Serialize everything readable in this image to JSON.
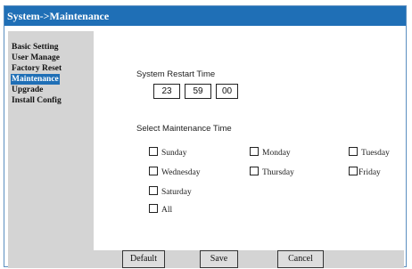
{
  "header": {
    "title": "System->Maintenance"
  },
  "sidebar": {
    "items": [
      {
        "label": "Basic Setting",
        "active": false
      },
      {
        "label": "User Manage",
        "active": false
      },
      {
        "label": "Factory Reset",
        "active": false
      },
      {
        "label": "Maintenance",
        "active": true
      },
      {
        "label": "Upgrade",
        "active": false
      },
      {
        "label": "Install Config",
        "active": false
      }
    ]
  },
  "main": {
    "restart_label": "System Restart Time",
    "restart_time": {
      "hour": "23",
      "minute": "59",
      "second": "00"
    },
    "select_label": "Select Maintenance Time",
    "days": [
      {
        "label": "Sunday",
        "checked": false
      },
      {
        "label": "Monday",
        "checked": false
      },
      {
        "label": "Tuesday",
        "checked": false
      },
      {
        "label": "Wednesday",
        "checked": false
      },
      {
        "label": "Thursday",
        "checked": false
      },
      {
        "label": "Friday",
        "checked": false
      },
      {
        "label": "Saturday",
        "checked": false
      },
      {
        "label": "All",
        "checked": false
      }
    ]
  },
  "buttons": {
    "default_label": "Default",
    "save_label": "Save",
    "cancel_label": "Cancel"
  },
  "colors": {
    "title_bar": "#1f6fb6",
    "panel_gray": "#d4d4d4",
    "active_item": "#1f6fb6"
  }
}
